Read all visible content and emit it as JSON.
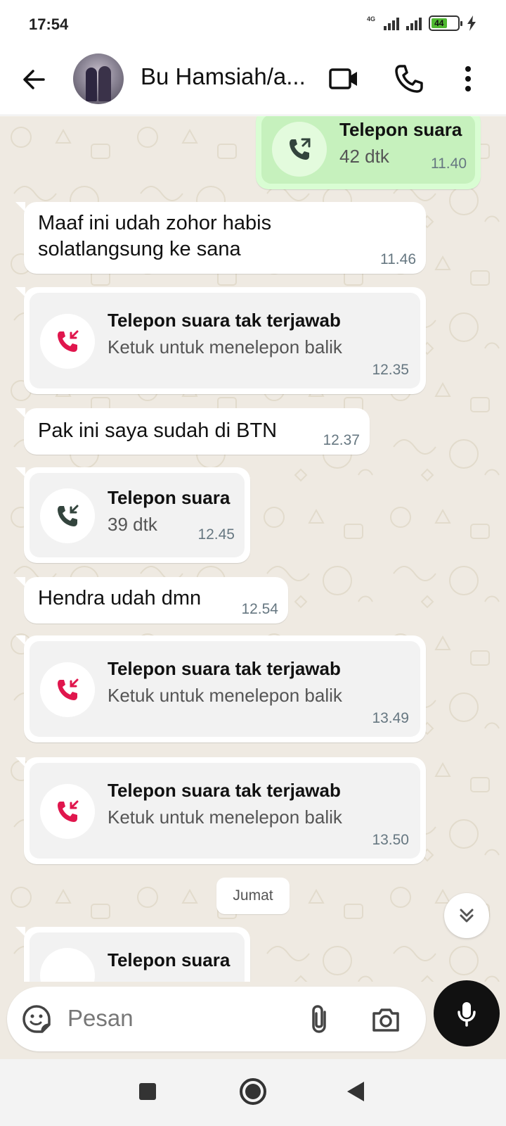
{
  "status_bar": {
    "time": "17:54",
    "network": "4G",
    "battery": "44"
  },
  "header": {
    "contact_name": "Bu Hamsiah/a..."
  },
  "messages": [
    {
      "type": "call",
      "title": "Telepon suara",
      "subtitle": "42 dtk",
      "time": "11.40",
      "direction": "outgoing"
    },
    {
      "type": "text",
      "line1": "Maaf ini udah zohor habis",
      "line2": "solatlangsung ke sana",
      "time": "11.46"
    },
    {
      "type": "missed_call",
      "title": "Telepon suara tak terjawab",
      "subtitle": "Ketuk untuk menelepon balik",
      "time": "12.35"
    },
    {
      "type": "text",
      "line1": "Pak ini saya sudah di BTN",
      "time": "12.37"
    },
    {
      "type": "call",
      "title": "Telepon suara",
      "subtitle": "39 dtk",
      "time": "12.45",
      "direction": "incoming"
    },
    {
      "type": "text",
      "line1": "Hendra udah dmn",
      "time": "12.54"
    },
    {
      "type": "missed_call",
      "title": "Telepon suara tak terjawab",
      "subtitle": "Ketuk untuk menelepon balik",
      "time": "13.49"
    },
    {
      "type": "missed_call",
      "title": "Telepon suara tak terjawab",
      "subtitle": "Ketuk untuk menelepon balik",
      "time": "13.50"
    },
    {
      "type": "call",
      "title": "Telepon suara",
      "direction": "incoming"
    }
  ],
  "date_divider": "Jumat",
  "input": {
    "placeholder": "Pesan"
  },
  "colors": {
    "chat_bg": "#efeae2",
    "outgoing_bubble": "#d9fdd3",
    "missed_call_red": "#e0164d",
    "timestamp": "#667781"
  },
  "icons": [
    "back-arrow-icon",
    "avatar",
    "video-call-icon",
    "voice-call-icon",
    "more-options-icon",
    "outgoing-call-icon",
    "missed-call-icon",
    "incoming-call-icon",
    "scroll-down-icon",
    "sticker-icon",
    "attach-icon",
    "camera-icon",
    "mic-icon"
  ]
}
